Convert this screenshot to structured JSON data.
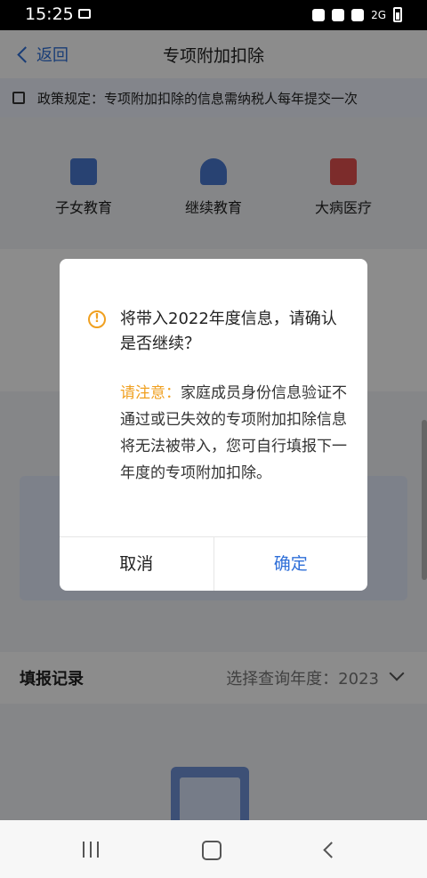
{
  "status_bar": {
    "time": "15:25",
    "network": "2G"
  },
  "header": {
    "back_label": "返回",
    "title": "专项附加扣除"
  },
  "notice": {
    "text": "政策规定：专项附加扣除的信息需纳税人每年提交一次"
  },
  "categories": [
    {
      "label": "子女教育",
      "icon": "books-icon",
      "color": "#4a78d0"
    },
    {
      "label": "继续教育",
      "icon": "graduation-cap-icon",
      "color": "#4a78d0"
    },
    {
      "label": "大病医疗",
      "icon": "medical-kit-icon",
      "color": "#e2514f"
    }
  ],
  "records": {
    "label": "填报记录",
    "year_label": "选择查询年度：2023"
  },
  "dialog": {
    "message": "将带入2022年度信息，请确认是否继续？",
    "note_highlight": "请注意：",
    "note_text": "家庭成员身份信息验证不通过或已失效的专项附加扣除信息将无法被带入，您可自行填报下一年度的专项附加扣除。",
    "cancel_label": "取消",
    "confirm_label": "确定"
  },
  "colors": {
    "accent": "#2f6fd8",
    "warning": "#f0a020"
  }
}
